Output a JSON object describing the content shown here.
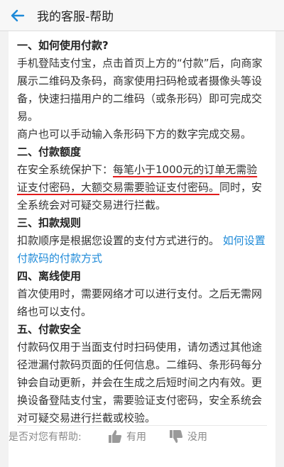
{
  "header": {
    "title": "我的客服-帮助"
  },
  "sections": [
    {
      "title": "一、如何使用付款?",
      "p1": "手机登陆支付宝，点击首页上方的“付款”后，向商家展示二维码及条码，商家使用扫码枪或者摄像头等设备，快速扫描用户的二维码（或条形码）即可完成交易。",
      "p2": "商户也可以手动输入条形码下方的数字完成交易。"
    },
    {
      "title": "二、付款额度",
      "lead": "在安全系统保护下：",
      "underlined": "每笔小于1000元的订单无需验证支付密码，大额交易需要验证支付密码。",
      "tail": "同时，安全系统会对可疑交易进行拦截。"
    },
    {
      "title": "三、扣款规则",
      "text": "扣款顺序是根据您设置的支付方式进行的。",
      "link": "如何设置付款码的付款方式"
    },
    {
      "title": "四、离线使用",
      "text": "首次使用时，需要网络才可以进行支付。之后无需网络也可以支付。"
    },
    {
      "title": "五、付款安全",
      "text": "付款码仅用于当面支付时扫码使用，请勿透过其他途径泄漏付款码页面的任何信息。二维码、条形码每分钟会自动更新，并会在生成之后短时间之内有效。更换设备登陆支付宝，需要验证支付密码，安全系统会对可疑交易进行拦截或校验。"
    }
  ],
  "feedback": {
    "question": "是否对您有帮助:",
    "useful": "有用",
    "useless": "没用"
  },
  "colors": {
    "accent": "#1e8ad8",
    "underline": "#e21b1b"
  },
  "icons": {
    "back": "back-arrow-icon",
    "up": "thumbs-up-icon",
    "down": "thumbs-down-icon"
  }
}
